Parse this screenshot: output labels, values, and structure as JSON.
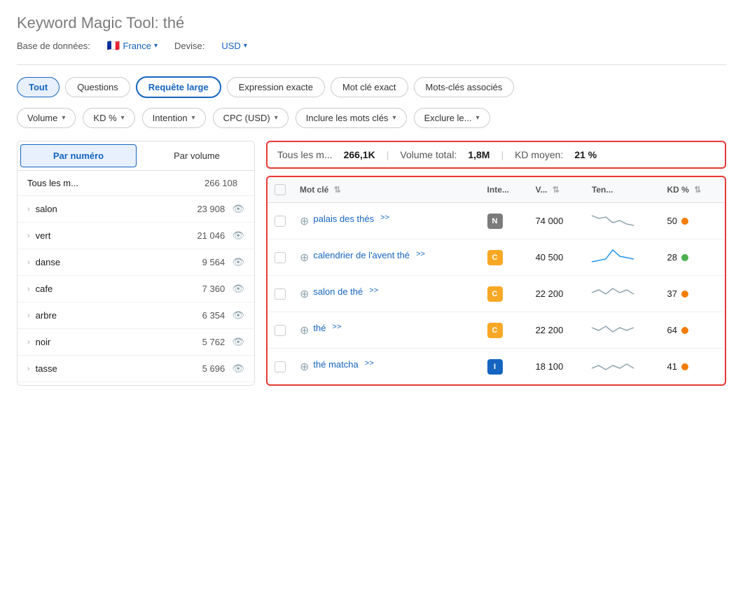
{
  "page": {
    "title": "Keyword Magic Tool:",
    "keyword": "thé"
  },
  "database": {
    "label": "Base de données:",
    "flag": "🇫🇷",
    "country": "France",
    "devise_label": "Devise:",
    "currency": "USD"
  },
  "tabs": [
    {
      "id": "tout",
      "label": "Tout",
      "active": true,
      "outline": true
    },
    {
      "id": "questions",
      "label": "Questions",
      "active": false
    },
    {
      "id": "requete-large",
      "label": "Requête large",
      "active": true,
      "outline": false
    },
    {
      "id": "expression-exacte",
      "label": "Expression exacte",
      "active": false
    },
    {
      "id": "mot-cle-exact",
      "label": "Mot clé exact",
      "active": false
    },
    {
      "id": "mots-cles-associes",
      "label": "Mots-clés associés",
      "active": false
    }
  ],
  "filters": [
    {
      "id": "volume",
      "label": "Volume"
    },
    {
      "id": "kd",
      "label": "KD %"
    },
    {
      "id": "intention",
      "label": "Intention"
    },
    {
      "id": "cpc",
      "label": "CPC (USD)"
    },
    {
      "id": "inclure",
      "label": "Inclure les mots clés"
    },
    {
      "id": "exclure",
      "label": "Exclure le..."
    }
  ],
  "sort_buttons": [
    {
      "id": "par-numero",
      "label": "Par numéro",
      "active": true
    },
    {
      "id": "par-volume",
      "label": "Par volume",
      "active": false
    }
  ],
  "sidebar": {
    "header": {
      "label": "Tous les m...",
      "count": "266 108"
    },
    "items": [
      {
        "label": "salon",
        "count": "23 908"
      },
      {
        "label": "vert",
        "count": "21 046"
      },
      {
        "label": "danse",
        "count": "9 564"
      },
      {
        "label": "cafe",
        "count": "7 360"
      },
      {
        "label": "arbre",
        "count": "6 354"
      },
      {
        "label": "noir",
        "count": "5 762"
      },
      {
        "label": "tasse",
        "count": "5 696"
      }
    ]
  },
  "stats": {
    "label": "Tous les m...",
    "count": "266,1K",
    "volume_label": "Volume total:",
    "volume": "1,8M",
    "kd_label": "KD moyen:",
    "kd": "21 %"
  },
  "table": {
    "columns": [
      {
        "id": "mot-cle",
        "label": "Mot clé",
        "sortable": true
      },
      {
        "id": "intention",
        "label": "Inte...",
        "sortable": false
      },
      {
        "id": "volume",
        "label": "V...",
        "sortable": true
      },
      {
        "id": "tendance",
        "label": "Ten...",
        "sortable": false
      },
      {
        "id": "kd",
        "label": "KD %",
        "sortable": true
      }
    ],
    "rows": [
      {
        "id": 1,
        "keyword": "palais des thés",
        "arrows": ">>",
        "intent": "N",
        "intent_class": "intent-n",
        "volume": "74 000",
        "kd": 50,
        "kd_color": "kd-orange",
        "trend": "down-wave"
      },
      {
        "id": 2,
        "keyword": "calendrier de l'avent thé",
        "arrows": ">>",
        "intent": "C",
        "intent_class": "intent-c",
        "volume": "40 500",
        "kd": 28,
        "kd_color": "kd-green",
        "trend": "spike"
      },
      {
        "id": 3,
        "keyword": "salon de thé",
        "arrows": ">>",
        "intent": "C",
        "intent_class": "intent-c",
        "volume": "22 200",
        "kd": 37,
        "kd_color": "kd-orange",
        "trend": "wave"
      },
      {
        "id": 4,
        "keyword": "thé",
        "arrows": ">>",
        "intent": "C",
        "intent_class": "intent-c",
        "volume": "22 200",
        "kd": 64,
        "kd_color": "kd-orange",
        "trend": "wave2"
      },
      {
        "id": 5,
        "keyword": "thé matcha",
        "arrows": ">>",
        "intent": "I",
        "intent_class": "intent-i",
        "volume": "18 100",
        "kd": 41,
        "kd_color": "kd-orange",
        "trend": "wave3"
      }
    ]
  }
}
